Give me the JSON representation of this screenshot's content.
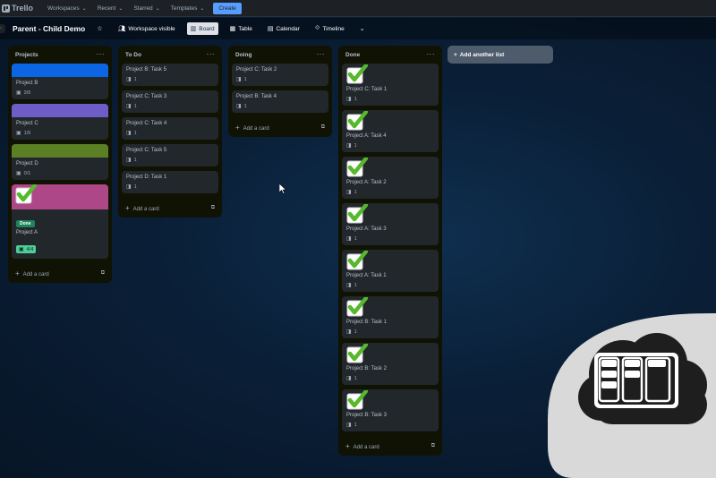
{
  "topnav": {
    "logo": "Trello",
    "items": [
      "Workspaces",
      "Recent",
      "Starred",
      "Templates"
    ],
    "create_label": "Create"
  },
  "board": {
    "title": "Parent - Child Demo",
    "visibility": "Workspace visible",
    "views": [
      "Board",
      "Table",
      "Calendar",
      "Timeline"
    ],
    "add_list_label": "Add another list"
  },
  "colors": {
    "blue_cover": "#0c66e4",
    "purple_cover": "#6e5dc6",
    "green_cover": "#5b7f24",
    "magenta_cover": "#ae4787",
    "done_label": "#1f845a",
    "check_green": "#56b82b"
  },
  "lists": {
    "projects": {
      "title": "Projects",
      "add_label": "Add a card",
      "cards": [
        {
          "title": "Project B",
          "badge": "3/5"
        },
        {
          "title": "Project C",
          "badge": "1/5"
        },
        {
          "title": "Project D",
          "badge": "0/1"
        },
        {
          "title": "Project A",
          "label": "Done",
          "badge": "4/4"
        }
      ]
    },
    "todo": {
      "title": "To Do",
      "add_label": "Add a card",
      "cards": [
        {
          "title": "Project B: Task 5",
          "badge": "1"
        },
        {
          "title": "Project C: Task 3",
          "badge": "1"
        },
        {
          "title": "Project C: Task 4",
          "badge": "1"
        },
        {
          "title": "Project C: Task 5",
          "badge": "1"
        },
        {
          "title": "Project D: Task 1",
          "badge": "1"
        }
      ]
    },
    "doing": {
      "title": "Doing",
      "add_label": "Add a card",
      "cards": [
        {
          "title": "Project C: Task 2",
          "badge": "1"
        },
        {
          "title": "Project B: Task 4",
          "badge": "1"
        }
      ]
    },
    "done": {
      "title": "Done",
      "add_label": "Add a card",
      "cards": [
        {
          "title": "Project C: Task 1",
          "badge": "1"
        },
        {
          "title": "Project A: Task 4",
          "badge": "1"
        },
        {
          "title": "Project A: Task 2",
          "badge": "1"
        },
        {
          "title": "Project A: Task 3",
          "badge": "1"
        },
        {
          "title": "Project A: Task 1",
          "badge": "1"
        },
        {
          "title": "Project B: Task 1",
          "badge": "1"
        },
        {
          "title": "Project B: Task 2",
          "badge": "1"
        },
        {
          "title": "Project B: Task 3",
          "badge": "1"
        }
      ]
    }
  },
  "icons": {
    "checklist": "checklist-icon",
    "child": "child-board-icon",
    "check": "checkmark-icon",
    "template": "card-template-icon"
  }
}
